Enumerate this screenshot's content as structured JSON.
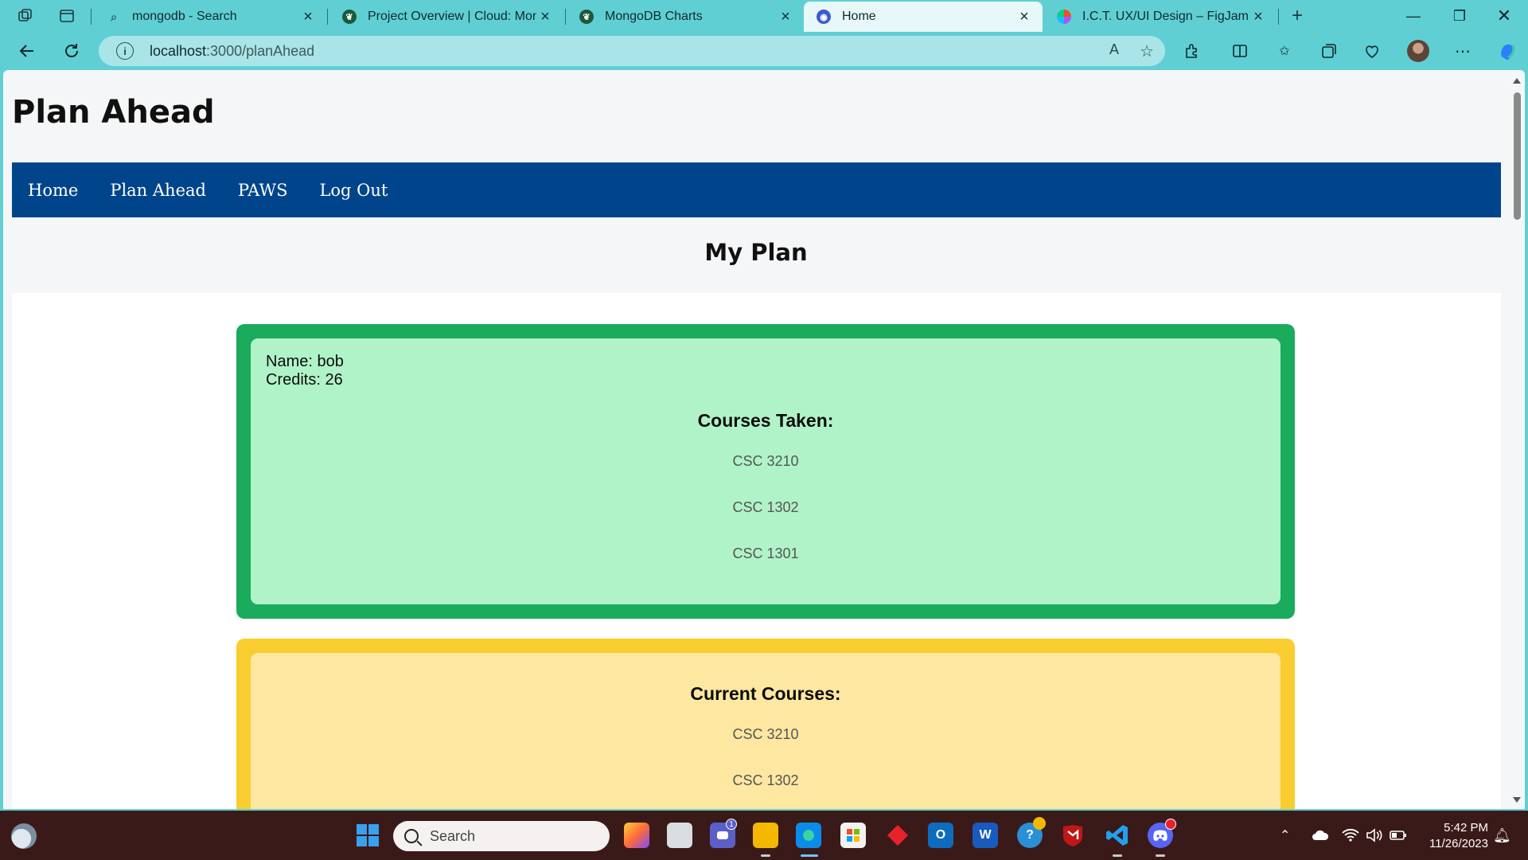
{
  "browser": {
    "tabs": [
      {
        "title": "mongodb - Search",
        "icon": "search-icon",
        "active": false
      },
      {
        "title": "Project Overview | Cloud: MongoDB",
        "icon": "mongodb-leaf-icon",
        "active": false
      },
      {
        "title": "MongoDB Charts",
        "icon": "mongodb-leaf-icon",
        "active": false
      },
      {
        "title": "Home",
        "icon": "app-favicon",
        "active": true
      },
      {
        "title": "I.C.T. UX/UI Design – FigJam",
        "icon": "figma-icon",
        "active": false
      }
    ],
    "address": {
      "host": "localhost",
      "path": ":3000/planAhead"
    },
    "read_aloud_label": "A"
  },
  "page": {
    "app_title": "Plan Ahead",
    "nav": [
      "Home",
      "Plan Ahead",
      "PAWS",
      "Log Out"
    ],
    "heading": "My Plan",
    "student": {
      "name_line": "Name: bob",
      "credits_line": "Credits: 26"
    },
    "courses_taken": {
      "title": "Courses Taken:",
      "items": [
        "CSC 3210",
        "CSC 1302",
        "CSC 1301"
      ]
    },
    "current_courses": {
      "title": "Current Courses:",
      "items": [
        "CSC 3210",
        "CSC 1302"
      ]
    },
    "colors": {
      "nav": "#00458b",
      "taken_border": "#1aab5d",
      "taken_fill": "#b0f3c8",
      "current_border": "#f9cd2f",
      "current_fill": "#fde7a1"
    }
  },
  "taskbar": {
    "search_placeholder": "Search",
    "badges": {
      "teams": "1"
    },
    "clock_time": "5:42 PM",
    "clock_date": "11/26/2023"
  }
}
